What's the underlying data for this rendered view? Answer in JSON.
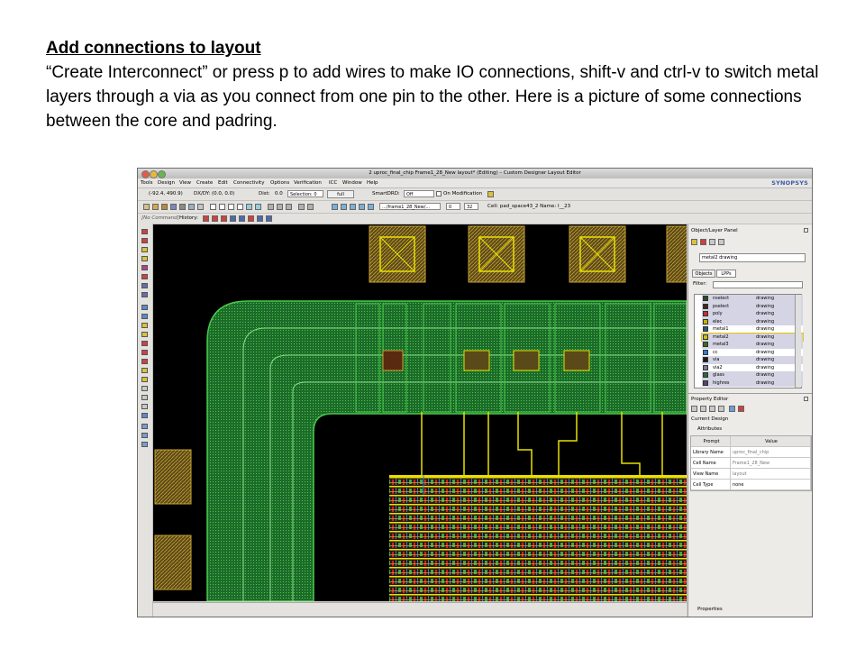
{
  "slide": {
    "title": "Add connections to layout",
    "body": "“Create Interconnect” or press p to add wires to make IO connections, shift-v and ctrl-v to switch metal layers through a via as you connect from one pin to the other.  Here is a picture of some connections between the core and padring."
  },
  "window": {
    "title": "2 uproc_final_chip Frame1_28_New layout* (Editing) – Custom Designer Layout Editor",
    "brand": "SYNOPSYS",
    "menu": [
      "Tools",
      "Design",
      "View",
      "Create",
      "Edit",
      "Connectivity",
      "Options",
      "Verification",
      "ICC",
      "Window",
      "Help"
    ]
  },
  "toolbar": {
    "coords": "(-92.4,   490.9)",
    "dxdy_label": "DX/DY:",
    "dxdy_value": "(0.0,    0.0)",
    "dist_label": "Dist:",
    "dist_value": "0.0",
    "selection": "Selection: 0",
    "full_button": "full",
    "smartdrd_label": "SmartDRD:",
    "smartdrd_value": "Off",
    "on_modification": "On Modification",
    "path": ".../frame1_28_New/...",
    "level_value": "0",
    "depth_value": "32",
    "cell_info": "Cell: pad_space43_2 Name: I__23",
    "command": "[No Command]",
    "history_label": "History:"
  },
  "panel": {
    "title": "Object/Layer Panel",
    "current_lpp": "metal2 drawing",
    "tabs": [
      "Objects",
      "LPPs"
    ],
    "filter_label": "Filter:",
    "layers": [
      {
        "name": "nselect",
        "purpose": "drawing",
        "color": "#2a4a22"
      },
      {
        "name": "pselect",
        "purpose": "drawing",
        "color": "#3a2a1a"
      },
      {
        "name": "poly",
        "purpose": "drawing",
        "color": "#c03030"
      },
      {
        "name": "elec",
        "purpose": "drawing",
        "color": "#c8b400"
      },
      {
        "name": "metal1",
        "purpose": "drawing",
        "color": "#2a5a6a"
      },
      {
        "name": "metal2",
        "purpose": "drawing",
        "color": "#c8c400"
      },
      {
        "name": "metal3",
        "purpose": "drawing",
        "color": "#3a6a2a"
      },
      {
        "name": "cc",
        "purpose": "drawing",
        "color": "#3080d0"
      },
      {
        "name": "via",
        "purpose": "drawing",
        "color": "#1a1a1a"
      },
      {
        "name": "via2",
        "purpose": "drawing",
        "color": "#7a7a9a"
      },
      {
        "name": "glass",
        "purpose": "drawing",
        "color": "#2a6a3a"
      },
      {
        "name": "highres",
        "purpose": "drawing",
        "color": "#4a4a6a"
      }
    ],
    "property_editor": "Property Editor",
    "current_design": "Current Design",
    "attributes": "Attributes",
    "col_prompt": "Prompt",
    "col_value": "Value",
    "attr_rows": [
      {
        "prompt": "Library Name",
        "value": "uproc_final_chip"
      },
      {
        "prompt": "Cell Name",
        "value": "Frame1_28_New"
      },
      {
        "prompt": "View Name",
        "value": "layout"
      },
      {
        "prompt": "Cell Type",
        "value": "none"
      }
    ],
    "properties": "Properties"
  },
  "colors": {
    "metal1": "#2aa846",
    "metal2": "#e8e000",
    "metal3": "#49c94a",
    "poly": "#d02020",
    "cc": "#2a7ad8"
  }
}
